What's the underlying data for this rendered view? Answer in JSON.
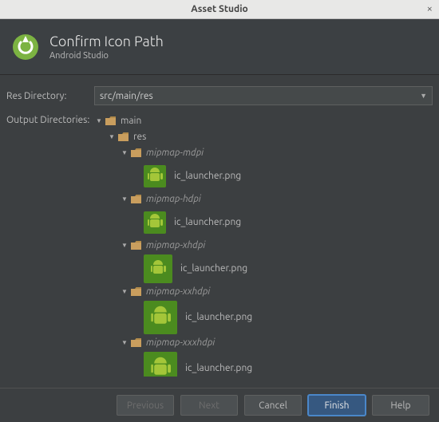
{
  "window": {
    "title": "Asset Studio"
  },
  "header": {
    "title": "Confirm Icon Path",
    "subtitle": "Android Studio"
  },
  "form": {
    "res_label": "Res Directory:",
    "res_value": "src/main/res",
    "output_label": "Output Directories:"
  },
  "tree": {
    "main": "main",
    "res": "res",
    "folders": [
      {
        "name": "mipmap-mdpi",
        "file": "ic_launcher.png",
        "thumbClass": "thumb"
      },
      {
        "name": "mipmap-hdpi",
        "file": "ic_launcher.png",
        "thumbClass": "thumb"
      },
      {
        "name": "mipmap-xhdpi",
        "file": "ic_launcher.png",
        "thumbClass": "thumb lg"
      },
      {
        "name": "mipmap-xxhdpi",
        "file": "ic_launcher.png",
        "thumbClass": "thumb xl"
      },
      {
        "name": "mipmap-xxxhdpi",
        "file": "ic_launcher.png",
        "thumbClass": "thumb xl"
      }
    ]
  },
  "buttons": {
    "previous": "Previous",
    "next": "Next",
    "cancel": "Cancel",
    "finish": "Finish",
    "help": "Help"
  }
}
